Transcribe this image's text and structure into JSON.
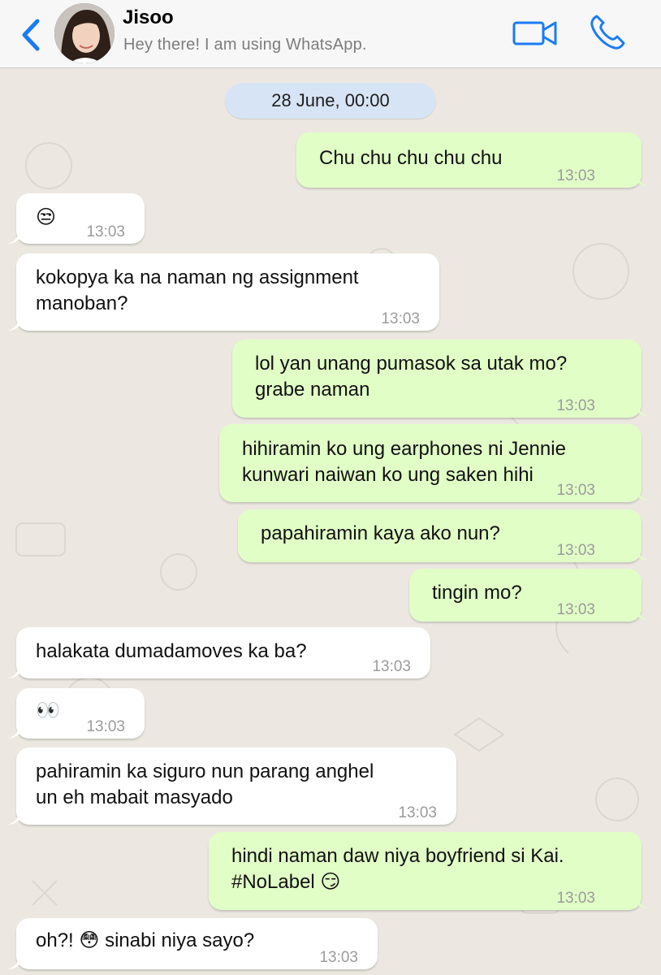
{
  "header": {
    "contact_name": "Jisoo",
    "status": "Hey there! I am using WhatsApp.",
    "icons": {
      "back": "chevron-left-icon",
      "video": "video-camera-icon",
      "call": "phone-icon"
    },
    "accent_color": "#1a7cf4"
  },
  "chat": {
    "date_label": "28 June, 00:00",
    "colors": {
      "incoming": "#ffffff",
      "outgoing": "#e1fec6",
      "background": "#ece8e1"
    },
    "messages": [
      {
        "dir": "out",
        "text": "Chu chu chu chu chu",
        "time": "13:03"
      },
      {
        "dir": "in",
        "text": "😒",
        "time": "13:03"
      },
      {
        "dir": "in",
        "text": "kokopya ka na naman ng assignment\nmanoban?",
        "time": "13:03"
      },
      {
        "dir": "out",
        "text": "lol yan unang pumasok sa utak mo?\ngrabe naman",
        "time": "13:03"
      },
      {
        "dir": "out",
        "text": "hihiramin ko ung earphones ni Jennie\nkunwari naiwan ko ung saken hihi",
        "time": "13:03"
      },
      {
        "dir": "out",
        "text": "papahiramin kaya ako nun?",
        "time": "13:03"
      },
      {
        "dir": "out",
        "text": "tingin mo?",
        "time": "13:03"
      },
      {
        "dir": "in",
        "text": "halakata dumadamoves ka ba?",
        "time": "13:03"
      },
      {
        "dir": "in",
        "text": "👀",
        "time": "13:03"
      },
      {
        "dir": "in",
        "text": "pahiramin ka siguro nun parang anghel\nun eh mabait masyado",
        "time": "13:03"
      },
      {
        "dir": "out",
        "text": "hindi naman daw niya boyfriend si Kai.\n#NoLabel 😏",
        "time": "13:03"
      },
      {
        "dir": "in",
        "text": "oh?! 😳 sinabi niya sayo?",
        "time": "13:03"
      }
    ]
  }
}
